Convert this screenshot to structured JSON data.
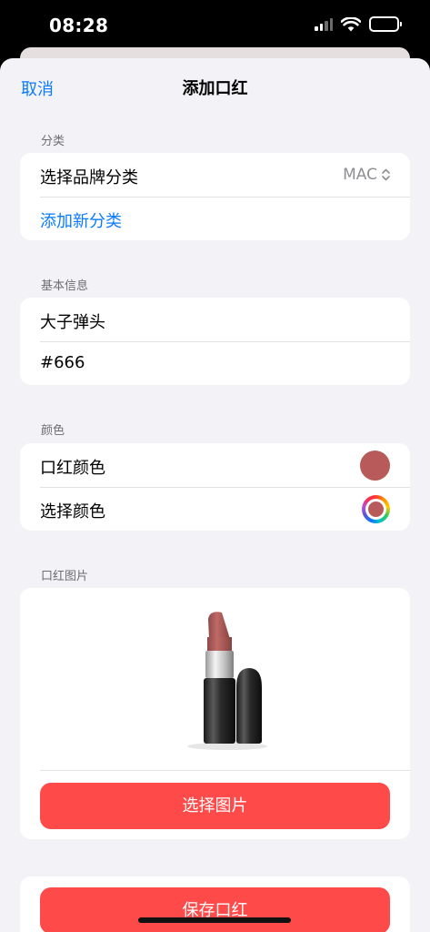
{
  "status_bar": {
    "time": "08:28"
  },
  "nav": {
    "cancel_label": "取消",
    "title": "添加口红"
  },
  "category_section": {
    "label": "分类",
    "choose_brand_label": "选择品牌分类",
    "selected_brand": "MAC",
    "add_category_label": "添加新分类"
  },
  "basic_info_section": {
    "label": "基本信息",
    "name_value": "大子弹头",
    "code_value": "#666"
  },
  "color_section": {
    "label": "颜色",
    "lipstick_color_label": "口红颜色",
    "choose_color_label": "选择颜色",
    "swatch_color": "#b75a59"
  },
  "image_section": {
    "label": "口红图片",
    "choose_image_label": "选择图片"
  },
  "save_label": "保存口红",
  "colors": {
    "accent": "#0a7aff",
    "button": "#ff4a4a",
    "background": "#f2f2f7"
  }
}
